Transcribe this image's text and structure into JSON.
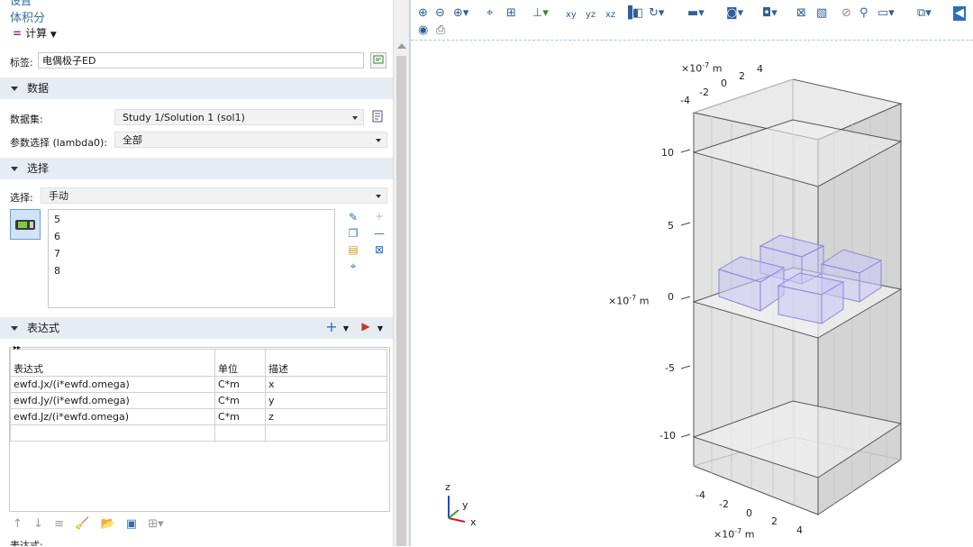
{
  "panel": {
    "header_top": "设置",
    "header_sub": "体积分",
    "calc_label": "计算",
    "label_caption": "标签:",
    "label_value": "电偶极子ED",
    "section_data": "数据",
    "dataset_label": "数据集:",
    "dataset_value": "Study 1/Solution 1 (sol1)",
    "param_label": "参数选择 (lambda0):",
    "param_value": "全部",
    "section_selection": "选择",
    "selection_label": "选择:",
    "selection_value": "手动",
    "selection_items": [
      "5",
      "6",
      "7",
      "8"
    ],
    "section_expr": "表达式",
    "table_headers": [
      "表达式",
      "单位",
      "描述"
    ],
    "table_rows": [
      [
        "ewfd.Jx/(i*ewfd.omega)",
        "C*m",
        "x"
      ],
      [
        "ewfd.Jy/(i*ewfd.omega)",
        "C*m",
        "y"
      ],
      [
        "ewfd.Jz/(i*ewfd.omega)",
        "C*m",
        "z"
      ]
    ],
    "last_label": "表达式:"
  },
  "viewport": {
    "unit_label": "×10",
    "unit_exp": "-7",
    "unit_suffix": " m",
    "z_ticks": [
      "10",
      "5",
      "0",
      "-5",
      "-10"
    ],
    "top_x_ticks": [
      "-4",
      "-2",
      "0",
      "2",
      "4"
    ],
    "bottom_x_ticks": [
      "-4",
      "-2",
      "0",
      "2",
      "4"
    ],
    "triad": {
      "z": "z",
      "y": "y",
      "x": "x"
    }
  },
  "colors": {
    "accent": "#3b6ea5",
    "section_bg": "#e7ecf2",
    "box_fill": "#dcdcdc",
    "cube_fill": "#c9c6f2",
    "cube_stroke": "#8c88d6"
  },
  "toolbar_icons": [
    "zoom-in-icon",
    "zoom-out-icon",
    "zoom-box-icon",
    "zoom-extents-icon",
    "go-to-default-view-icon",
    "axes-icon",
    "xy-view-icon",
    "yz-view-icon",
    "xz-view-icon",
    "transparency-icon",
    "rotate-icon",
    "lights-icon",
    "scene-light-icon",
    "render-icon",
    "select-objects-icon",
    "wireframe-icon",
    "hide-icon",
    "grid-icon",
    "screenshot-icon",
    "print-icon"
  ]
}
